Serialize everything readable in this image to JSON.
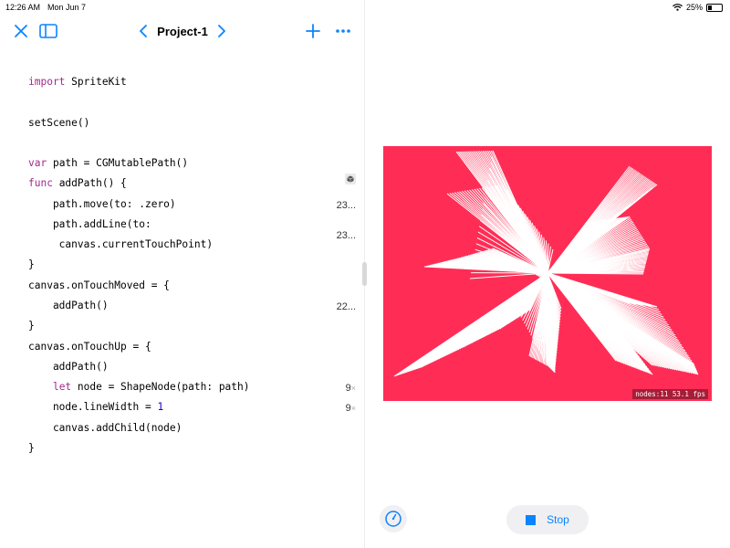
{
  "status_bar": {
    "time": "12:26 AM",
    "date": "Mon Jun 7",
    "battery_text": "25%",
    "battery_level": 0.25
  },
  "toolbar": {
    "title": "Project-1",
    "icons": {
      "close": "close-icon",
      "sidebar": "sidebar-icon",
      "back": "chevron-left-icon",
      "forward": "chevron-right-icon",
      "add": "plus-icon",
      "more": "ellipsis-icon"
    }
  },
  "code": {
    "l1_kw": "import",
    "l1_rest": " SpriteKit",
    "l2": "setScene()",
    "l3_kw": "var",
    "l3_rest": " path = CGMutablePath()",
    "l4_kw": "func",
    "l4_rest": " addPath() {",
    "l5": "    path.move(to: .zero)",
    "l6": "    path.addLine(to:",
    "l7": "     canvas.currentTouchPoint)",
    "l8": "}",
    "l9": "canvas.onTouchMoved = {",
    "l10": "    addPath()",
    "l11": "}",
    "l12": "canvas.onTouchUp = {",
    "l13": "    addPath()",
    "l14_pre": "    ",
    "l14_kw": "let",
    "l14_rest": " node = ShapeNode(path: path)",
    "l15_pre": "    node.lineWidth = ",
    "l15_num": "1",
    "l16": "    canvas.addChild(node)",
    "l17": "}"
  },
  "annotations": {
    "move": "23...",
    "addline": "23...",
    "touchmoved": "22...",
    "shapenode_count": "9",
    "linewidth_count": "9",
    "multiplier": "×"
  },
  "canvas": {
    "background": "#ff2d55",
    "stroke": "#ffffff",
    "nodes_text": "nodes:11",
    "fps_text": "53.1 fps"
  },
  "controls": {
    "stop_label": "Stop",
    "speed_icon": "speedometer-icon",
    "stop_icon": "stop-icon"
  },
  "colors": {
    "accent": "#0a84ff",
    "keyword": "#a2298c",
    "number": "#1c00cf"
  }
}
